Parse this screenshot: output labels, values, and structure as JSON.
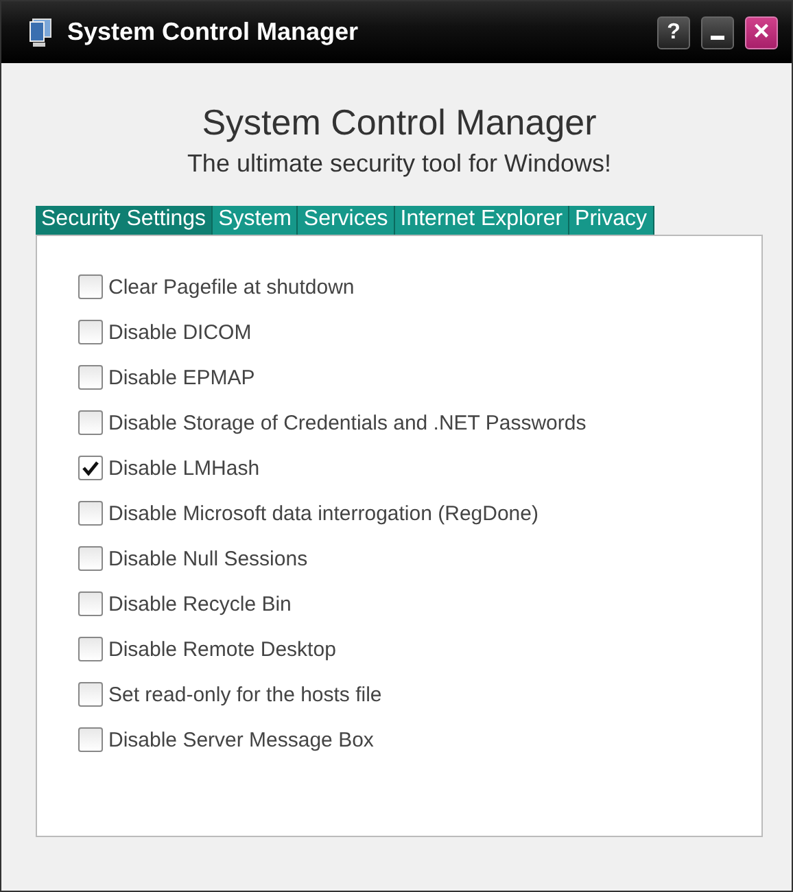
{
  "window": {
    "title": "System Control Manager",
    "buttons": [
      {
        "kind": "help",
        "label": "?"
      },
      {
        "kind": "minimize"
      },
      {
        "kind": "close",
        "label": "×"
      }
    ]
  },
  "heading": "System Control Manager",
  "subtitle": "The ultimate security tool for Windows!",
  "tabs": [
    {
      "label": "Security Settings",
      "selected": true
    },
    {
      "label": "System",
      "selected": false
    },
    {
      "label": "Services",
      "selected": false
    },
    {
      "label": "Internet Explorer",
      "selected": false
    },
    {
      "label": "Privacy",
      "selected": false
    }
  ],
  "options": [
    {
      "label": "Clear Pagefile at shutdown",
      "checked": false
    },
    {
      "label": "Disable DICOM",
      "checked": false
    },
    {
      "label": "Disable EPMAP",
      "checked": false
    },
    {
      "label": "Disable Storage of Credentials and .NET Passwords",
      "checked": false
    },
    {
      "label": "Disable LMHash",
      "checked": true
    },
    {
      "label": "Disable Microsoft data interrogation (RegDone)",
      "checked": false
    },
    {
      "label": "Disable Null Sessions",
      "checked": false
    },
    {
      "label": "Disable Recycle Bin",
      "checked": false
    },
    {
      "label": "Disable Remote Desktop",
      "checked": false
    },
    {
      "label": "Set read-only for the hosts file",
      "checked": false
    },
    {
      "label": "Disable Server Message Box",
      "checked": false
    }
  ]
}
